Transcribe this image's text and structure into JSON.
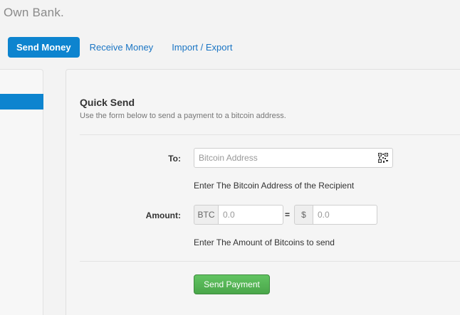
{
  "header": {
    "brand": "Own Bank."
  },
  "nav": {
    "tabs": [
      {
        "label": "Send Money",
        "active": true
      },
      {
        "label": "Receive Money",
        "active": false
      },
      {
        "label": "Import / Export",
        "active": false
      }
    ]
  },
  "quick_send": {
    "title": "Quick Send",
    "subtitle": "Use the form below to send a payment to a bitcoin address.",
    "to_label": "To:",
    "address_placeholder": "Bitcoin Address",
    "address_help": "Enter The Bitcoin Address of the Recipient",
    "amount_label": "Amount:",
    "btc_addon": "BTC",
    "btc_placeholder": "0.0",
    "equals": "=",
    "usd_addon": "$",
    "usd_placeholder": "0.0",
    "amount_help": "Enter The Amount of Bitcoins to send",
    "send_button": "Send Payment"
  },
  "colors": {
    "accent": "#0d84cf",
    "link": "#1a75c4",
    "success": "#5bb75b"
  },
  "icons": {
    "qr": "qr-code-icon"
  }
}
